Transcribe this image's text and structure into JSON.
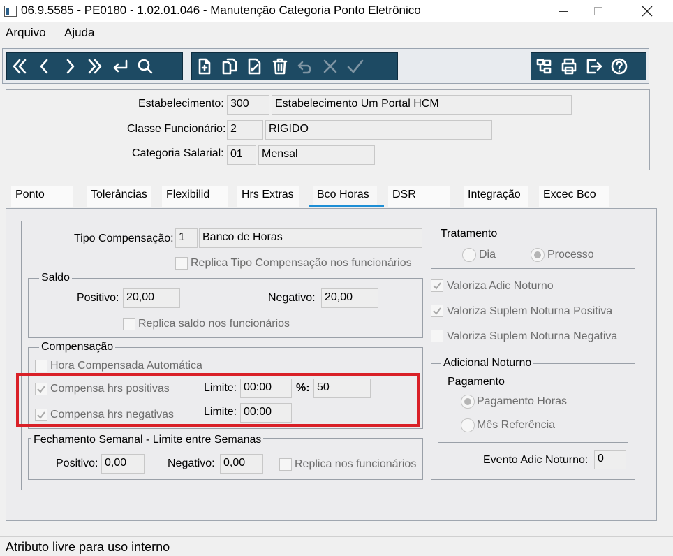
{
  "window": {
    "title": "06.9.5585 - PE0180 - 1.02.01.046 - Manutenção Categoria Ponto Eletrônico"
  },
  "menu": {
    "items": [
      "Arquivo",
      "Ajuda"
    ]
  },
  "toolbar": {
    "nav_icons": [
      "first-icon",
      "previous-icon",
      "next-icon",
      "last-icon",
      "goto-icon",
      "search-icon"
    ],
    "edit_icons": [
      "new-icon",
      "copy-icon",
      "edit-icon",
      "delete-icon",
      "undo-icon",
      "cancel-icon",
      "confirm-icon"
    ],
    "extra_icons": [
      "structure-icon",
      "print-icon",
      "exit-icon",
      "help-icon"
    ]
  },
  "header": {
    "estabelecimento_label": "Estabelecimento:",
    "estabelecimento_code": "300",
    "estabelecimento_name": "Estabelecimento Um Portal HCM",
    "classe_label": "Classe Funcionário:",
    "classe_code": "2",
    "classe_name": "RIGIDO",
    "categoria_label": "Categoria Salarial:",
    "categoria_code": "01",
    "categoria_name": "Mensal"
  },
  "tabs": [
    "Ponto",
    "Tolerâncias",
    "Flexibilid",
    "Hrs Extras",
    "Bco Horas",
    "DSR",
    "Integração",
    "Excec Bco"
  ],
  "active_tab": "Bco Horas",
  "bco_horas": {
    "tipo_label": "Tipo Compensação:",
    "tipo_code": "1",
    "tipo_name": "Banco de Horas",
    "replica_tipo": "Replica Tipo Compensação nos funcionários",
    "saldo": {
      "title": "Saldo",
      "positivo_label": "Positivo:",
      "positivo": "20,00",
      "negativo_label": "Negativo:",
      "negativo": "20,00",
      "replica": "Replica saldo nos funcionários"
    },
    "compensacao": {
      "title": "Compensação",
      "hora_auto": "Hora Compensada Automática",
      "hrs_positivas": "Compensa hrs positivas",
      "limite_label": "Limite:",
      "limite_pos": "00:00",
      "pct_label": "%:",
      "pct": "50",
      "hrs_negativas": "Compensa hrs negativas",
      "limite_neg": "00:00"
    },
    "fechamento": {
      "title": "Fechamento Semanal - Limite entre Semanas",
      "positivo_label": "Positivo:",
      "positivo": "0,00",
      "negativo_label": "Negativo:",
      "negativo": "0,00",
      "replica": "Replica nos funcionários"
    },
    "tratamento": {
      "title": "Tratamento",
      "dia": "Dia",
      "processo": "Processo"
    },
    "valoriza_adic": "Valoriza Adic Noturno",
    "valoriza_pos": "Valoriza Suplem Noturna Positiva",
    "valoriza_neg": "Valoriza Suplem Noturna Negativa",
    "adicional": {
      "title": "Adicional Noturno",
      "pagamento_title": "Pagamento",
      "pag_horas": "Pagamento Horas",
      "mes_ref": "Mês Referência",
      "evento_label": "Evento Adic Noturno:",
      "evento": "0"
    }
  },
  "status": {
    "text": "Atributo livre para uso interno"
  },
  "colors": {
    "toolbar": "#1d4a63",
    "highlight": "#d92027",
    "tab_accent": "#1e8fd6"
  }
}
